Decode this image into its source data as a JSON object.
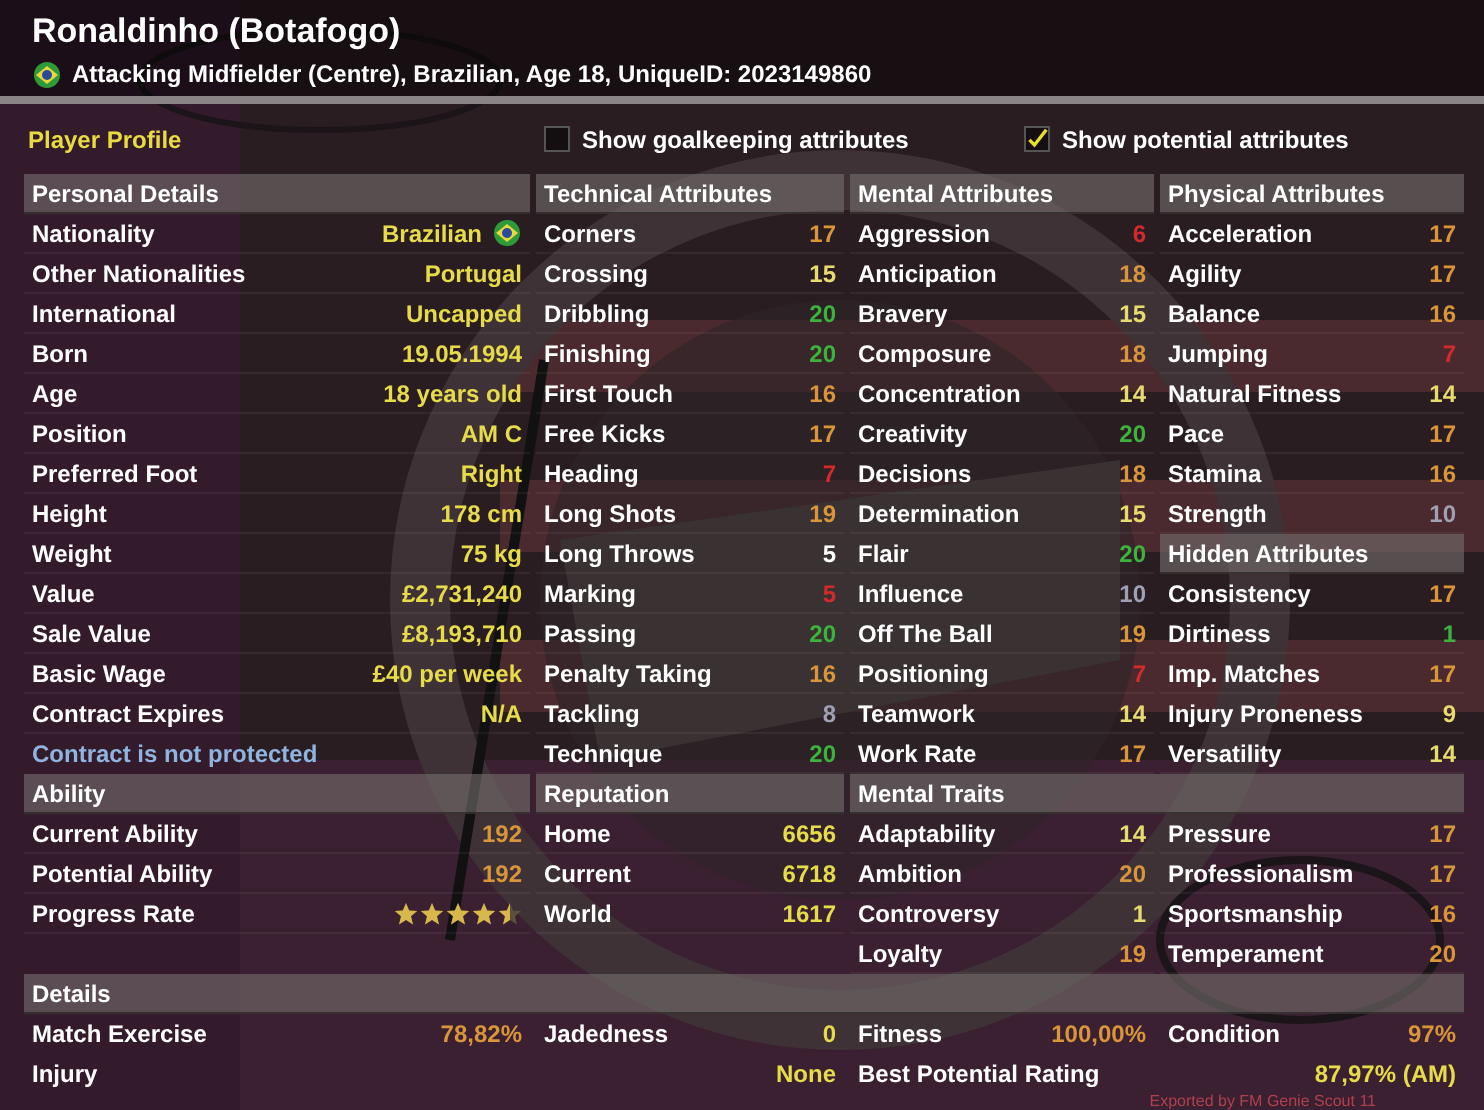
{
  "header": {
    "title": "Ronaldinho (Botafogo)",
    "subtitle": "Attacking Midfielder (Centre), Brazilian, Age 18, UniqueID: 2023149860"
  },
  "profile_label": "Player Profile",
  "options": [
    {
      "label": "Show goalkeeping attributes",
      "checked": false
    },
    {
      "label": "Show potential attributes",
      "checked": true
    }
  ],
  "personal": {
    "title": "Personal Details",
    "rows": [
      {
        "label": "Nationality",
        "value": "Brazilian",
        "flag": true
      },
      {
        "label": "Other Nationalities",
        "value": "Portugal",
        "flag": false
      },
      {
        "label": "International",
        "value": "Uncapped",
        "flag": false
      },
      {
        "label": "Born",
        "value": "19.05.1994",
        "flag": false
      },
      {
        "label": "Age",
        "value": "18 years old",
        "flag": false
      },
      {
        "label": "Position",
        "value": "AM C",
        "flag": false
      },
      {
        "label": "Preferred Foot",
        "value": "Right",
        "flag": false
      },
      {
        "label": "Height",
        "value": "178 cm",
        "flag": false
      },
      {
        "label": "Weight",
        "value": "75 kg",
        "flag": false
      },
      {
        "label": "Value",
        "value": "£2,731,240",
        "flag": false
      },
      {
        "label": "Sale Value",
        "value": "£8,193,710",
        "flag": false
      },
      {
        "label": "Basic Wage",
        "value": "£40 per week",
        "flag": false
      },
      {
        "label": "Contract Expires",
        "value": "N/A",
        "flag": false
      }
    ],
    "note": "Contract is not protected"
  },
  "technical": {
    "title": "Technical Attributes",
    "rows": [
      {
        "label": "Corners",
        "value": "17",
        "color": "#d9953a"
      },
      {
        "label": "Crossing",
        "value": "15",
        "color": "#e6dc6e"
      },
      {
        "label": "Dribbling",
        "value": "20",
        "color": "#3cb43c"
      },
      {
        "label": "Finishing",
        "value": "20",
        "color": "#3cb43c"
      },
      {
        "label": "First Touch",
        "value": "16",
        "color": "#d9953a"
      },
      {
        "label": "Free Kicks",
        "value": "17",
        "color": "#d9953a"
      },
      {
        "label": "Heading",
        "value": "7",
        "color": "#d42a2a"
      },
      {
        "label": "Long Shots",
        "value": "19",
        "color": "#d9953a"
      },
      {
        "label": "Long Throws",
        "value": "5",
        "color": "#ffffff"
      },
      {
        "label": "Marking",
        "value": "5",
        "color": "#d42a2a"
      },
      {
        "label": "Passing",
        "value": "20",
        "color": "#3cb43c"
      },
      {
        "label": "Penalty Taking",
        "value": "16",
        "color": "#d9953a"
      },
      {
        "label": "Tackling",
        "value": "8",
        "color": "#a0a0b4"
      },
      {
        "label": "Technique",
        "value": "20",
        "color": "#3cb43c"
      }
    ]
  },
  "mental": {
    "title": "Mental Attributes",
    "rows": [
      {
        "label": "Aggression",
        "value": "6",
        "color": "#d42a2a"
      },
      {
        "label": "Anticipation",
        "value": "18",
        "color": "#d9953a"
      },
      {
        "label": "Bravery",
        "value": "15",
        "color": "#e6dc6e"
      },
      {
        "label": "Composure",
        "value": "18",
        "color": "#d9953a"
      },
      {
        "label": "Concentration",
        "value": "14",
        "color": "#e6dc6e"
      },
      {
        "label": "Creativity",
        "value": "20",
        "color": "#3cb43c"
      },
      {
        "label": "Decisions",
        "value": "18",
        "color": "#d9953a"
      },
      {
        "label": "Determination",
        "value": "15",
        "color": "#e6dc6e"
      },
      {
        "label": "Flair",
        "value": "20",
        "color": "#3cb43c"
      },
      {
        "label": "Influence",
        "value": "10",
        "color": "#a0a0b4"
      },
      {
        "label": "Off The Ball",
        "value": "19",
        "color": "#d9953a"
      },
      {
        "label": "Positioning",
        "value": "7",
        "color": "#d42a2a"
      },
      {
        "label": "Teamwork",
        "value": "14",
        "color": "#e6dc6e"
      },
      {
        "label": "Work Rate",
        "value": "17",
        "color": "#d9953a"
      }
    ]
  },
  "physical": {
    "title": "Physical Attributes",
    "rows": [
      {
        "label": "Acceleration",
        "value": "17",
        "color": "#d9953a"
      },
      {
        "label": "Agility",
        "value": "17",
        "color": "#d9953a"
      },
      {
        "label": "Balance",
        "value": "16",
        "color": "#d9953a"
      },
      {
        "label": "Jumping",
        "value": "7",
        "color": "#d42a2a"
      },
      {
        "label": "Natural Fitness",
        "value": "14",
        "color": "#e6dc6e"
      },
      {
        "label": "Pace",
        "value": "17",
        "color": "#d9953a"
      },
      {
        "label": "Stamina",
        "value": "16",
        "color": "#d9953a"
      },
      {
        "label": "Strength",
        "value": "10",
        "color": "#a0a0b4"
      }
    ]
  },
  "hidden": {
    "title": "Hidden Attributes",
    "rows": [
      {
        "label": "Consistency",
        "value": "17",
        "color": "#d9953a"
      },
      {
        "label": "Dirtiness",
        "value": "1",
        "color": "#3cb43c"
      },
      {
        "label": "Imp. Matches",
        "value": "17",
        "color": "#d9953a"
      },
      {
        "label": "Injury Proneness",
        "value": "9",
        "color": "#e6dc6e"
      },
      {
        "label": "Versatility",
        "value": "14",
        "color": "#e6dc6e"
      }
    ]
  },
  "ability": {
    "title": "Ability",
    "rows": [
      {
        "kind": "text",
        "label": "Current Ability",
        "value": "192"
      },
      {
        "kind": "text",
        "label": "Potential Ability",
        "value": "192"
      },
      {
        "kind": "stars",
        "label": "Progress Rate",
        "stars": 4.5
      }
    ]
  },
  "reputation": {
    "title": "Reputation",
    "rows": [
      {
        "label": "Home",
        "value": "6656"
      },
      {
        "label": "Current",
        "value": "6718"
      },
      {
        "label": "World",
        "value": "1617"
      }
    ]
  },
  "mental_traits": {
    "title": "Mental Traits",
    "left": [
      {
        "label": "Adaptability",
        "value": "14",
        "color": "#e6dc6e"
      },
      {
        "label": "Ambition",
        "value": "20",
        "color": "#d9953a"
      },
      {
        "label": "Controversy",
        "value": "1",
        "color": "#e6dc6e"
      },
      {
        "label": "Loyalty",
        "value": "19",
        "color": "#d9953a"
      }
    ],
    "right": [
      {
        "label": "Pressure",
        "value": "17",
        "color": "#d9953a"
      },
      {
        "label": "Professionalism",
        "value": "17",
        "color": "#d9953a"
      },
      {
        "label": "Sportsmanship",
        "value": "16",
        "color": "#d9953a"
      },
      {
        "label": "Temperament",
        "value": "20",
        "color": "#d9953a"
      }
    ]
  },
  "details": {
    "title": "Details",
    "cells": [
      {
        "label": "Match Exercise",
        "value": "78,82%",
        "color": "#d9953a"
      },
      {
        "label": "Jadedness",
        "value": "0",
        "color": "#e6dc4a"
      },
      {
        "label": "Fitness",
        "value": "100,00%",
        "color": "#d9953a"
      },
      {
        "label": "Condition",
        "value": "97%",
        "color": "#d9953a"
      },
      {
        "label": "Injury"
      },
      {
        "value": "None",
        "color": "#e6dc4a"
      },
      {
        "label": "Best Potential Rating"
      },
      {
        "value": "87,97% (AM)",
        "color": "#e6dc4a"
      }
    ]
  },
  "footer": "Exported by FM Genie Scout 11"
}
